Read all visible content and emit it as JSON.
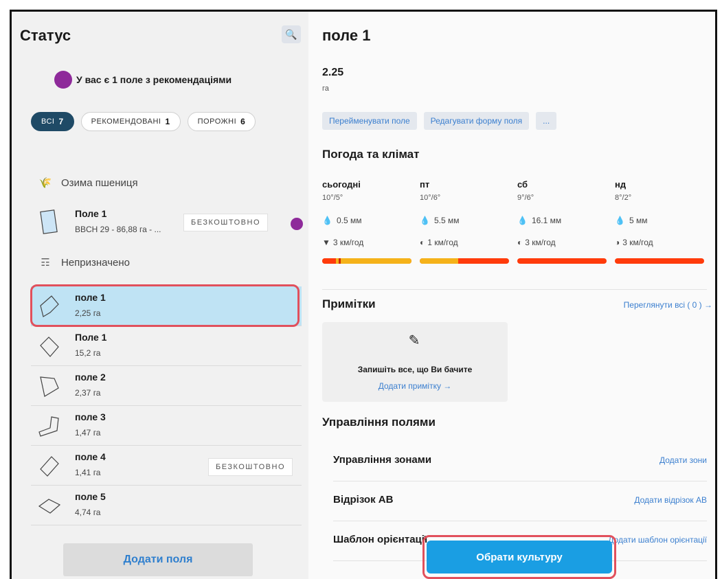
{
  "left": {
    "title": "Статус",
    "recommendation": "У вас є 1 поле з рекомендаціями",
    "filters": [
      {
        "label": "ВСІ",
        "count": "7"
      },
      {
        "label": "РЕКОМЕНДОВАНІ",
        "count": "1"
      },
      {
        "label": "ПОРОЖНІ",
        "count": "6"
      }
    ],
    "groups": {
      "winter_wheat": "Озима пшениця",
      "unassigned": "Непризначено"
    },
    "rows": [
      {
        "name": "Поле 1",
        "area": "BBCH 29 - 86,88 га - ...",
        "badge": "БЕЗКОШТОВНО"
      },
      {
        "name": "поле 1",
        "area": "2,25 га"
      },
      {
        "name": "Поле 1",
        "area": "15,2 га"
      },
      {
        "name": "поле 2",
        "area": "2,37 га"
      },
      {
        "name": "поле 3",
        "area": "1,47 га"
      },
      {
        "name": "поле 4",
        "area": "1,41 га",
        "badge": "БЕЗКОШТОВНО"
      },
      {
        "name": "поле 5",
        "area": "4,74 га"
      }
    ],
    "add_fields": "Додати поля"
  },
  "right": {
    "title": "поле 1",
    "area": "2.25",
    "unit": "га",
    "actions": [
      "Перейменувати поле",
      "Редагувати форму поля",
      "..."
    ],
    "weather_title": "Погода та клімат",
    "weather": [
      {
        "day": "сьогодні",
        "temp": "10°/5°",
        "rain": "0.5 мм",
        "wind": "3 км/год"
      },
      {
        "day": "пт",
        "temp": "10°/6°",
        "rain": "5.5 мм",
        "wind": "1 км/год"
      },
      {
        "day": "сб",
        "temp": "9°/6°",
        "rain": "16.1 мм",
        "wind": "3 км/год"
      },
      {
        "day": "нд",
        "temp": "8°/2°",
        "rain": "5 мм",
        "wind": "3 км/год"
      }
    ],
    "notes_title": "Примітки",
    "notes_view_all": "Переглянути всі ( 0 ) →",
    "notes_prompt": "Запишіть все, що Ви бачите",
    "notes_add": "Додати примітку →",
    "management_title": "Управління полями",
    "management": [
      {
        "label": "Управління зонами",
        "action": "Додати зони"
      },
      {
        "label": "Відрізок АВ",
        "action": "Додати відрізок АВ"
      },
      {
        "label": "Шаблон орієнтації",
        "action": "Додати шаблон орієнтації"
      }
    ],
    "choose_crop": "Обрати культуру"
  },
  "colors": {
    "accent": "#1a9ee3",
    "selected_row": "#bfe3f4",
    "highlight": "#e1505c",
    "recommend_dot": "#8e2a9a"
  }
}
